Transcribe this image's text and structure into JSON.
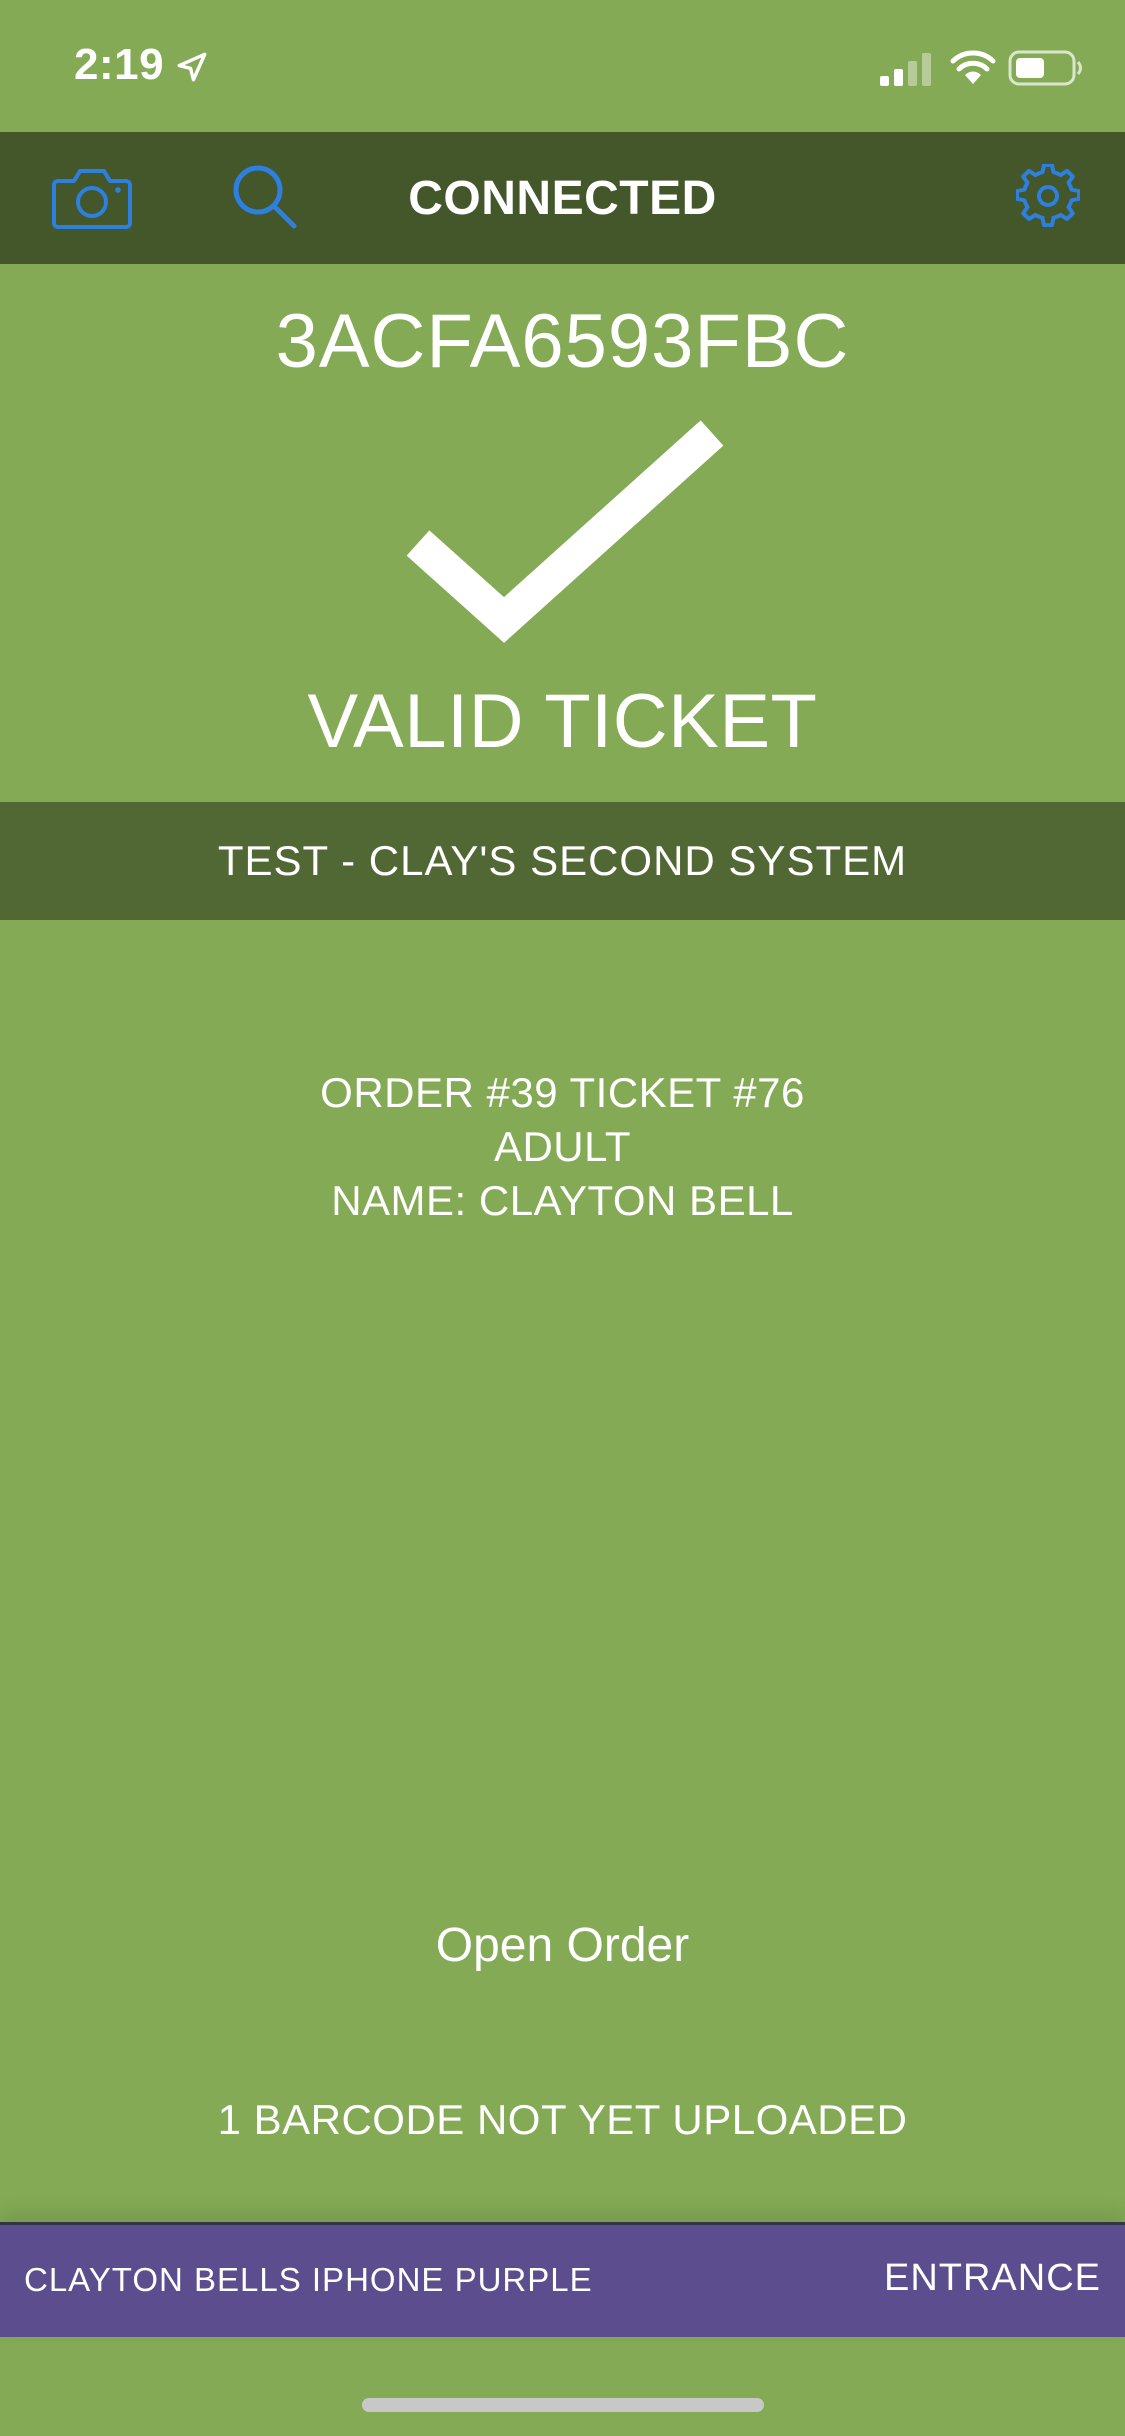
{
  "status_bar": {
    "time": "2:19",
    "icons": [
      "location-arrow-icon",
      "signal-icon",
      "wifi-icon",
      "battery-icon"
    ]
  },
  "toolbar": {
    "title": "CONNECTED",
    "icons": [
      "camera-icon",
      "search-icon",
      "gear-icon"
    ],
    "icon_color": "#2d7fe0",
    "background": "#43572b"
  },
  "scan": {
    "barcode": "3ACFA6593FBC",
    "result": "VALID TICKET",
    "result_icon": "checkmark-icon"
  },
  "event": {
    "name": "TEST - CLAY'S SECOND SYSTEM"
  },
  "ticket": {
    "lines": [
      "ORDER #39 TICKET #76",
      "ADULT",
      "NAME: CLAYTON BELL"
    ]
  },
  "actions": {
    "open_order": "Open Order"
  },
  "sync": {
    "status": "1 BARCODE NOT YET UPLOADED"
  },
  "footer": {
    "device": "CLAYTON BELLS IPHONE PURPLE",
    "station": "ENTRANCE",
    "background": "#5c4d8e"
  },
  "colors": {
    "page_background": "#84aa55",
    "band": "#516835",
    "text": "#ffffff"
  }
}
